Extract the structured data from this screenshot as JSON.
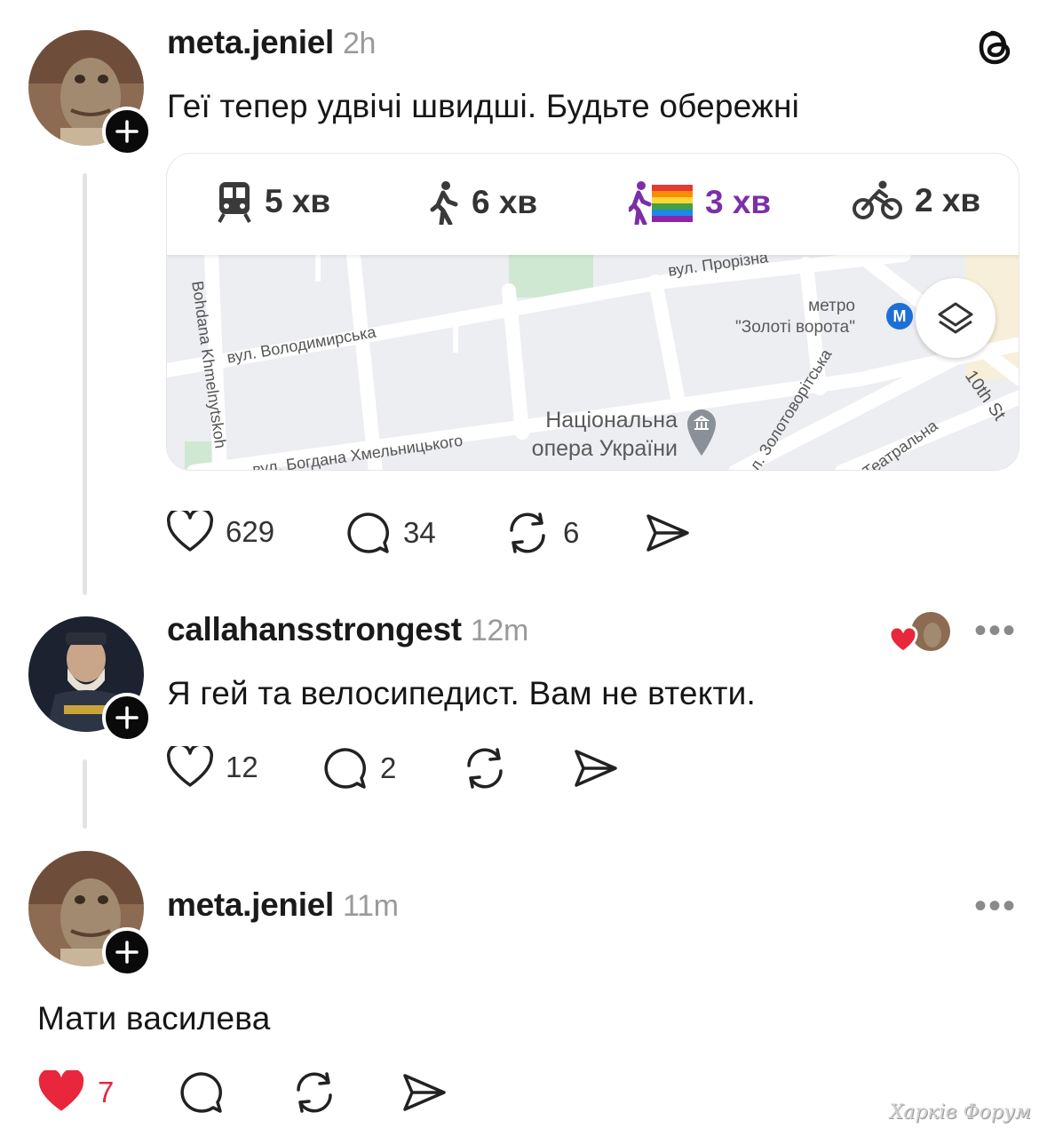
{
  "app": {
    "logo_icon": "threads-icon"
  },
  "post": {
    "username": "meta.jeniel",
    "time": "2h",
    "text": "Геї тепер удвічі швидші. Будьте обережні",
    "route_modes": [
      {
        "icon": "train-icon",
        "label": "5 хв"
      },
      {
        "icon": "walk-icon",
        "label": "6 хв"
      },
      {
        "icon": "rainbow-walk-icon",
        "label": "3 хв",
        "color": "#7b2fa8"
      },
      {
        "icon": "bike-icon",
        "label": "2 хв"
      }
    ],
    "map": {
      "streets": {
        "prorizna": "вул. Прорізна",
        "volodymyrska": "вул. Володимирська",
        "khmelnytskoho": "вул. Богдана Хмельницького",
        "bohdana_vertical": "Bohdana Khmelnytskoh",
        "zolotovoritska": "л. Золотоворітська",
        "teatralna": "Театральна",
        "tenth": "10th St"
      },
      "metro_line1": "метро",
      "metro_line2": "\"Золоті ворота\"",
      "metro_badge": "M",
      "opera_line1": "Національна",
      "opera_line2": "опера України"
    },
    "likes": "629",
    "comments": "34",
    "reposts": "6"
  },
  "reply1": {
    "username": "callahansstrongest",
    "time": "12m",
    "text": "Я гей та велосипедист. Вам не втекти.",
    "likes": "12",
    "comments": "2",
    "more": "•••"
  },
  "reply2": {
    "username": "meta.jeniel",
    "time": "11m",
    "text": "Мати василева",
    "likes": "7",
    "more": "•••"
  },
  "watermark": "Харків Форум",
  "colors": {
    "liked": "#e8263c",
    "rainbow_text": "#7b2fa8"
  }
}
